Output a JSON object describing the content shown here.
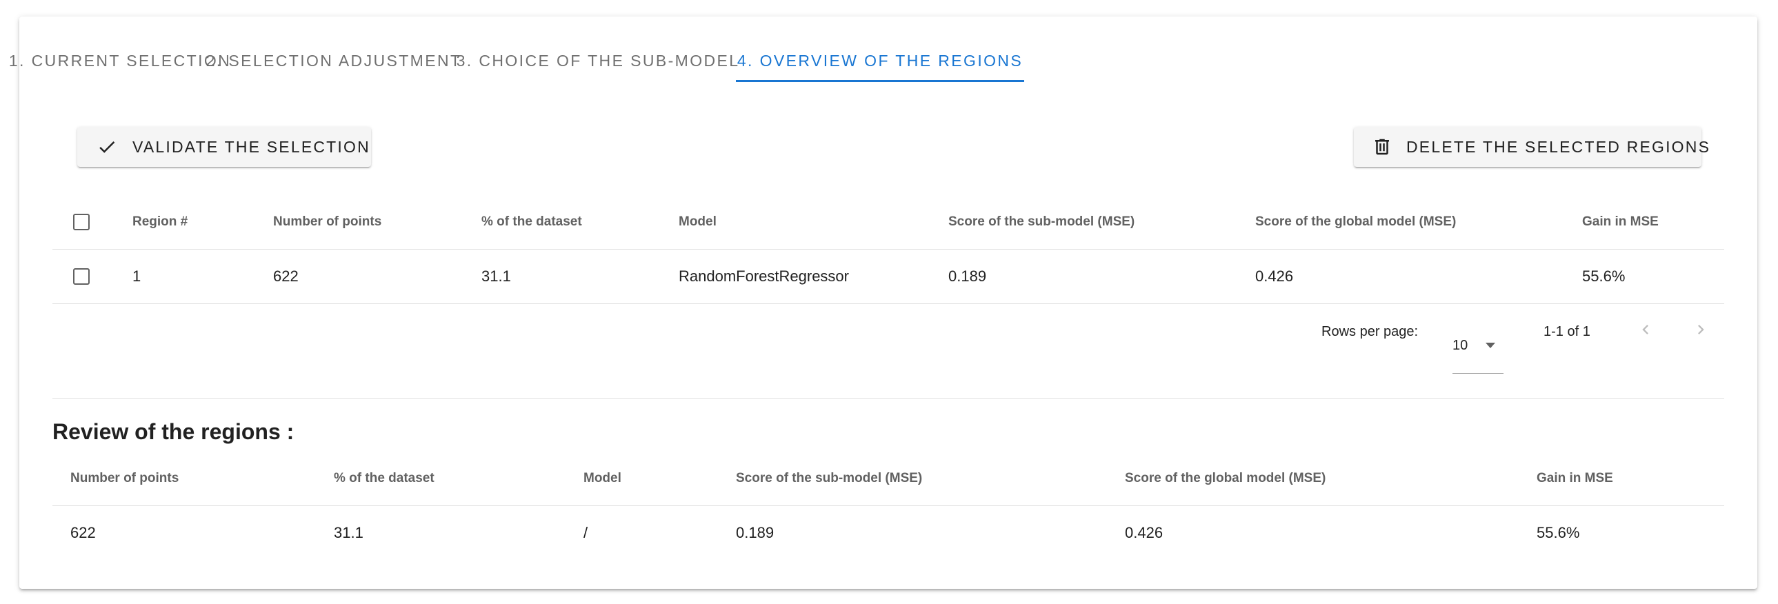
{
  "tabs": [
    {
      "label": "1. CURRENT SELECTION"
    },
    {
      "label": "2. SELECTION ADJUSTMENT"
    },
    {
      "label": "3. CHOICE OF THE SUB-MODEL"
    },
    {
      "label": "4. OVERVIEW OF THE REGIONS"
    }
  ],
  "active_tab_color": "#1976d2",
  "actions": {
    "validate_label": "VALIDATE THE SELECTION",
    "validate_icon": "check-icon",
    "delete_label": "DELETE THE SELECTED REGIONS",
    "delete_icon": "trash-icon"
  },
  "regions_table": {
    "headers": [
      "Region #",
      "Number of points",
      "% of the dataset",
      "Model",
      "Score of the sub-model (MSE)",
      "Score of the global model (MSE)",
      "Gain in MSE"
    ],
    "rows": [
      {
        "region": "1",
        "points": "622",
        "percent": "31.1",
        "model": "RandomForestRegressor",
        "sub_score": "0.189",
        "global_score": "0.426",
        "gain": "55.6%",
        "selected": false
      }
    ]
  },
  "pagination": {
    "rows_per_page_label": "Rows per page:",
    "rows_per_page_value": "10",
    "range_text": "1-1 of 1"
  },
  "review": {
    "title": "Review of the regions :",
    "headers": [
      "Number of points",
      "% of the dataset",
      "Model",
      "Score of the sub-model (MSE)",
      "Score of the global model (MSE)",
      "Gain in MSE"
    ],
    "rows": [
      {
        "points": "622",
        "percent": "31.1",
        "model": "/",
        "sub_score": "0.189",
        "global_score": "0.426",
        "gain": "55.6%"
      }
    ]
  }
}
